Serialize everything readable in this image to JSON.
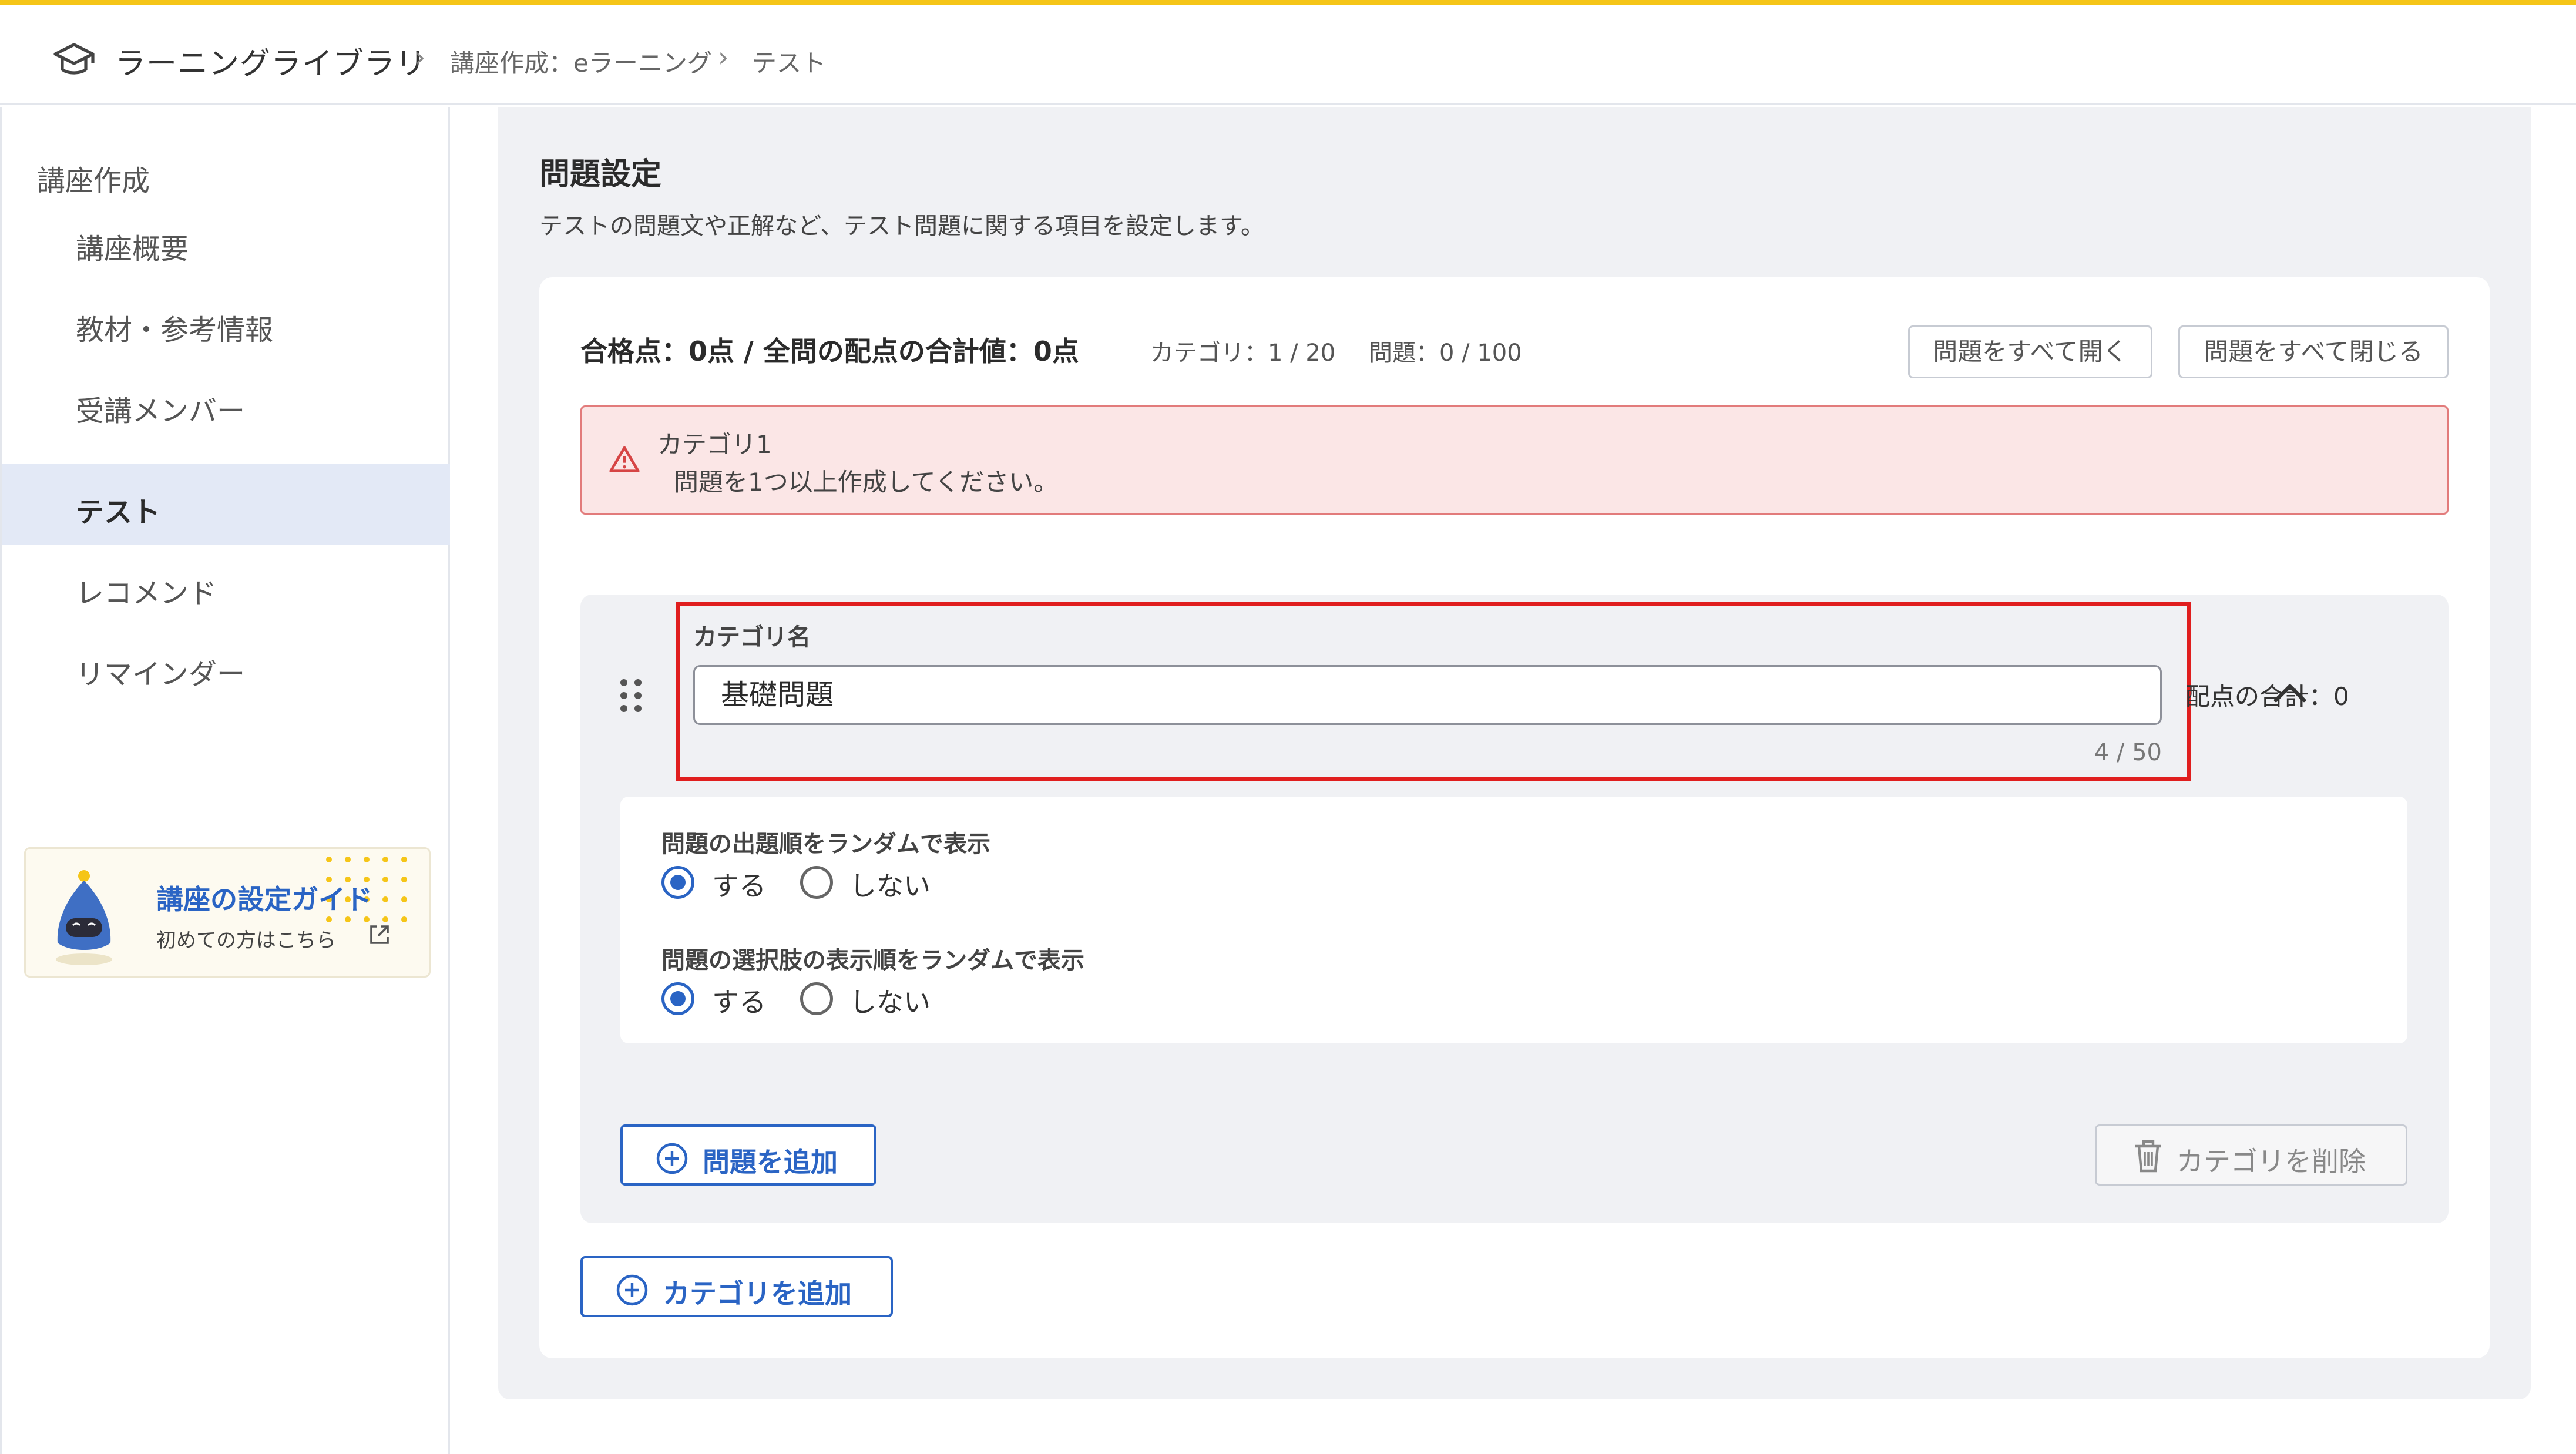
{
  "header": {
    "app_title": "ラーニングライブラリ",
    "breadcrumb": [
      "講座作成：eラーニング",
      "テスト"
    ],
    "separator": "›"
  },
  "sidebar": {
    "section_title": "講座作成",
    "items": [
      {
        "label": "講座概要",
        "active": false
      },
      {
        "label": "教材・参考情報",
        "active": false
      },
      {
        "label": "受講メンバー",
        "active": false
      },
      {
        "label": "テスト",
        "active": true
      },
      {
        "label": "レコメンド",
        "active": false
      },
      {
        "label": "リマインダー",
        "active": false
      }
    ],
    "guide": {
      "title": "講座の設定ガイド",
      "subtitle": "初めての方はこちら"
    }
  },
  "main": {
    "title": "問題設定",
    "description": "テストの問題文や正解など、テスト問題に関する項目を設定します。",
    "summary": "合格点：0点 / 全問の配点の合計値：0点",
    "category_count": "カテゴリ：1 / 20",
    "question_count": "問題：0 / 100",
    "expand_all_label": "問題をすべて開く",
    "collapse_all_label": "問題をすべて閉じる",
    "alert": {
      "title": "カテゴリ1",
      "message": "問題を1つ以上作成してください。"
    },
    "category": {
      "name_label": "カテゴリ名",
      "name_value": "基礎問題",
      "char_counter": "4 / 50",
      "score_total": "配点の合計：0",
      "option_groups": [
        {
          "label": "問題の出題順をランダムで表示",
          "yes": "する",
          "no": "しない",
          "selected": "yes"
        },
        {
          "label": "問題の選択肢の表示順をランダムで表示",
          "yes": "する",
          "no": "しない",
          "selected": "yes"
        }
      ],
      "add_question_label": "問題を追加",
      "delete_category_label": "カテゴリを削除"
    },
    "add_category_label": "カテゴリを追加"
  },
  "colors": {
    "accent": "#2a64c4",
    "top_border": "#f5c518",
    "alert_bg": "#fbe6e6",
    "alert_border": "#e27b7b",
    "highlight": "#e01e1e"
  },
  "icons": [
    "graduation-cap-icon",
    "chevron-right-icon",
    "warning-icon",
    "drag-handle-icon",
    "chevron-up-icon",
    "plus-circle-icon",
    "trash-icon",
    "external-link-icon",
    "robot-mascot-icon"
  ]
}
